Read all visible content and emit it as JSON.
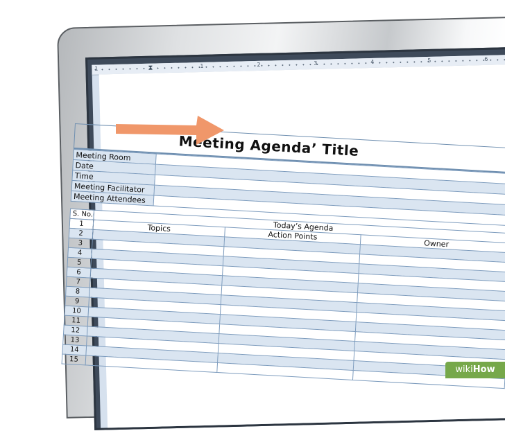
{
  "ruler": {
    "numbers": [
      "1",
      "1",
      "2",
      "3",
      "4",
      "5",
      "6"
    ]
  },
  "document": {
    "title": "Meeting Agenda’ Title",
    "info_rows": [
      {
        "label": "Meeting Room"
      },
      {
        "label": "Date"
      },
      {
        "label": "Time"
      },
      {
        "label": "Meeting Facilitator"
      },
      {
        "label": "Meeting Attendees"
      }
    ],
    "agenda": {
      "sno_header": "S. No.",
      "section_header": "Today’s Agenda",
      "col_topics": "Topics",
      "col_action": "Action Points",
      "col_owner": "Owner",
      "rows": [
        "1",
        "2",
        "3",
        "4",
        "5",
        "6",
        "7",
        "8",
        "9",
        "10",
        "11",
        "12",
        "13",
        "14",
        "15"
      ]
    }
  },
  "colors": {
    "arrow": "#f0976a",
    "table_border": "#7c9bbd",
    "row_shade": "#dae5f1",
    "badge": "#76a84a"
  },
  "badge": {
    "wiki": "wiki",
    "how": "How"
  }
}
